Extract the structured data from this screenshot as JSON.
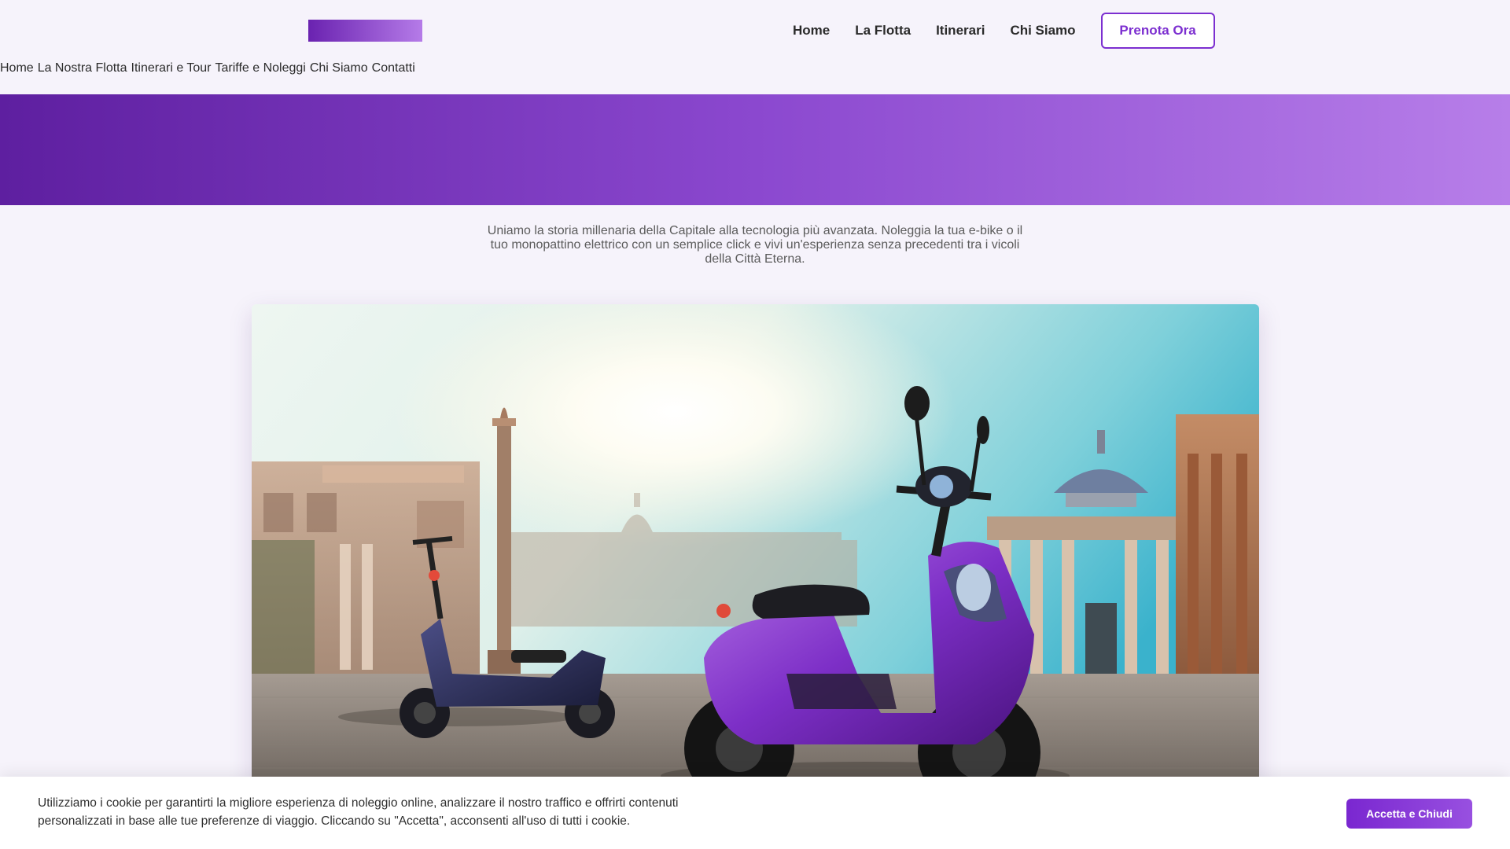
{
  "header": {
    "main_nav": [
      {
        "label": "Home"
      },
      {
        "label": "La Flotta"
      },
      {
        "label": "Itinerari"
      },
      {
        "label": "Chi Siamo"
      }
    ],
    "cta_label": "Prenota Ora"
  },
  "secondary_nav": [
    {
      "label": "Home"
    },
    {
      "label": "La Nostra Flotta"
    },
    {
      "label": "Itinerari e Tour"
    },
    {
      "label": "Tariffe e Noleggi"
    },
    {
      "label": "Chi Siamo"
    },
    {
      "label": "Contatti"
    }
  ],
  "intro": {
    "text": "Uniamo la storia millenaria della Capitale alla tecnologia più avanzata. Noleggia la tua e-bike o il tuo monopattino elettrico con un semplice click e vivi un'esperienza senza precedenti tra i vicoli della Città Eterna."
  },
  "hero_image": {
    "subject": "two electric scooters on a cobbled piazza in Rome with a column, domes and classical buildings at sunrise"
  },
  "cookie_banner": {
    "text": "Utilizziamo i cookie per garantirti la migliore esperienza di noleggio online, analizzare il nostro traffico e offrirti contenuti personalizzati in base alle tue preferenze di viaggio. Cliccando su \"Accetta\", acconsenti all'uso di tutti i cookie.",
    "button_label": "Accetta e Chiudi"
  },
  "colors": {
    "brand_purple": "#7c2fd0",
    "gradient_start": "#5e1fa0",
    "gradient_end": "#b77ee9",
    "page_background": "#f6f3fb"
  }
}
